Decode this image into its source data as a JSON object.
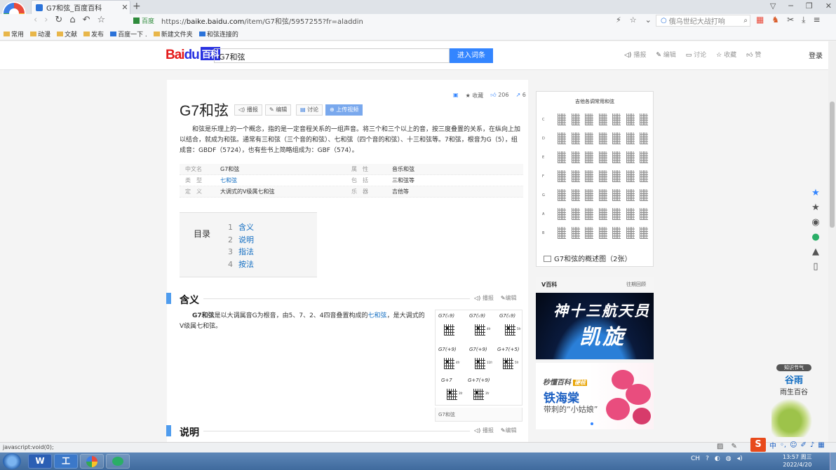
{
  "browser": {
    "tab_title": "G7和弦_百度百科",
    "url_secure_label": "百度",
    "url_prefix": "https://",
    "url_domain": "baike.baidu.com",
    "url_path": "/item/G7和弦/5957255?fr=aladdin",
    "search_placeholder": "俄乌世纪大战打响",
    "bookmarks": [
      "常用",
      "动漫",
      "文献",
      "发布",
      "百度一下 .",
      "新建文件夹",
      "和弦连接的"
    ],
    "status_text": "javascript:void(0);"
  },
  "header": {
    "logo_bai": "Bai",
    "logo_du": "du",
    "logo_baike": "百科",
    "search_value": "G7和弦",
    "search_button": "进入词条",
    "actions": [
      "播报",
      "编辑",
      "讨论",
      "收藏",
      "赞"
    ],
    "login": "登录"
  },
  "article": {
    "title": "G7和弦",
    "buttons": {
      "play": "播报",
      "edit": "编辑",
      "discuss": "讨论",
      "upload_video": "上传视频"
    },
    "stats": {
      "collect": "收藏",
      "likes": "206",
      "shares": "6"
    },
    "intro": "和弦是乐理上的一个概念，指的是一定音程关系的一组声音。将三个和三个以上的音，按三度叠置的关系，在纵向上加以结合，就成为和弦。通常有三和弦（三个音的和弦）、七和弦（四个音的和弦）、十三和弦等。7和弦，根音为G（5），组成音：GBDF（5724），也有些书上简略组成为：GBF（574）。",
    "infobox": [
      {
        "k1": "中文名",
        "v1": "G7和弦",
        "k2": "属　性",
        "v2": "音乐和弦"
      },
      {
        "k1": "类　型",
        "v1": "七和弦",
        "k2": "包　括",
        "v2": "三和弦等"
      },
      {
        "k1": "定　义",
        "v1": "大调式的V级属七和弦",
        "k2": "乐　器",
        "v2": "吉他等"
      }
    ],
    "toc_label": "目录",
    "toc": [
      {
        "n": "1",
        "t": "含义"
      },
      {
        "n": "2",
        "t": "说明"
      },
      {
        "n": "3",
        "t": "指法"
      },
      {
        "n": "4",
        "t": "按法"
      }
    ],
    "section1": {
      "title": "含义",
      "play": "播报",
      "edit": "编辑",
      "bold": "G7和弦",
      "text_a": "是以大调属音G为根音，由5、7、2、4四音叠置构成的",
      "link": "七和弦",
      "text_b": "，是大调式的V级属七和弦。",
      "image_caption": "G7和弦",
      "chords": [
        "G7(♭9)",
        "G7(♭9)",
        "G7(♭9)",
        "G7(+9)",
        "G7(+9)",
        "G+7(+5)",
        "G+7",
        "G+7(+9)"
      ],
      "frets": [
        "",
        "4fr",
        "5fr",
        "4fr",
        "11fr",
        "5fr",
        "3fr",
        "3fr"
      ]
    },
    "section2": {
      "title": "说明",
      "play": "播报",
      "edit": "编辑"
    }
  },
  "sidebar": {
    "album_title": "吉他各调常用和弦",
    "album_rows": [
      "C",
      "D",
      "E",
      "F",
      "G",
      "A",
      "B"
    ],
    "album_caption": "G7和弦的概述图（2张）",
    "vbaike_title": "V百科",
    "vbaike_more": "往期回顾",
    "ad1_line1": "神十三航天员",
    "ad1_line2": "凯旋",
    "ad2_brand": "秒懂百科",
    "ad2_tag": "硬核",
    "ad2_title": "铁海棠",
    "ad2_sub": "带刺的“小姑娘”",
    "guyu_badge": "知识节气",
    "guyu_title": "谷雨",
    "guyu_sub": "雨生百谷"
  },
  "taskbar": {
    "apps": [
      "W",
      "工",
      "",
      ""
    ],
    "time": "13:57 周三",
    "date": "2022/4/20",
    "tray_lang": "CH",
    "ime_logo": "S",
    "ime_mode": "中"
  },
  "colors": {
    "accent": "#3385ff",
    "link": "#136ec2",
    "brand_red": "#e41b1b",
    "brand_blue": "#2932e1",
    "section_bar": "#4f9cee"
  }
}
